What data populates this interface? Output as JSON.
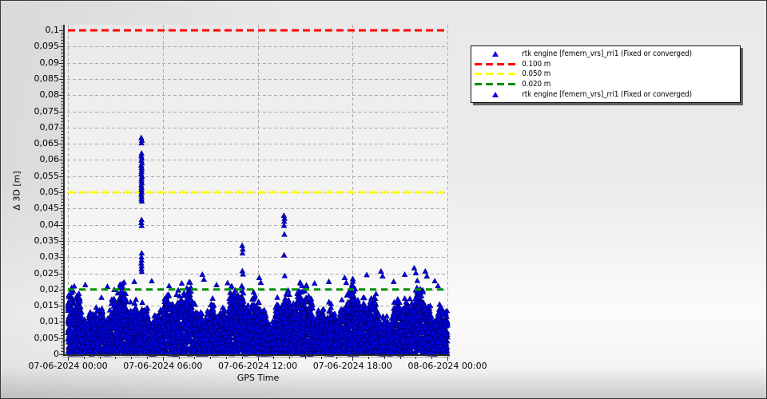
{
  "chart_data": {
    "type": "scatter",
    "title": "",
    "xlabel": "GPS Time",
    "ylabel": "Δ 3D [m]",
    "x_tick_labels": [
      "07-06-2024 00:00",
      "07-06-2024 06:00",
      "07-06-2024 12:00",
      "07-06-2024 18:00",
      "08-06-2024 00:00"
    ],
    "x_tick_hours": [
      0,
      6,
      12,
      18,
      24
    ],
    "x_minor_step_hours": 1,
    "ylim": [
      0,
      0.1
    ],
    "y_major_step": 0.005,
    "y_minor_step": 0.001,
    "y_tick_labels": [
      "0,1",
      "0,095",
      "0,09",
      "0,085",
      "0,08",
      "0,075",
      "0,07",
      "0,065",
      "0,06",
      "0,055",
      "0,05",
      "0,045",
      "0,04",
      "0,035",
      "0,03",
      "0,025",
      "0,02",
      "0,015",
      "0,01",
      "0,005",
      "0"
    ],
    "grid": "dashed",
    "legend_position": "top-right-outside",
    "series": [
      {
        "name": "rtk engine [femern_vrs]_rri1 (Fixed or converged)",
        "marker": "triangle",
        "color": "#0202ee"
      }
    ],
    "thresholds": [
      {
        "label": "0.100 m",
        "value": 0.1,
        "color": "#ff0000"
      },
      {
        "label": "0.050 m",
        "value": 0.05,
        "color": "#ffff00"
      },
      {
        "label": "0.020 m",
        "value": 0.02,
        "color": "#008f00"
      }
    ],
    "dense_band": {
      "y_min": 0.0,
      "y_typical_top": 0.016,
      "y_peak_top": 0.022,
      "point_count": 6000,
      "top_texture_points": 650
    },
    "band_envelope": {
      "base": 0.0135,
      "harmonics": [
        [
          0.003,
          1.7,
          2.0
        ],
        [
          0.002,
          4.3,
          0.0
        ],
        [
          0.0015,
          9.1,
          1.0
        ],
        [
          0.001,
          17.0,
          3.0
        ]
      ],
      "min": 0.0075,
      "max": 0.0215
    },
    "outlier_points": [
      [
        4.64,
        0.0668
      ],
      [
        4.68,
        0.066
      ],
      [
        4.65,
        0.0652
      ],
      [
        4.66,
        0.062
      ],
      [
        4.64,
        0.0612
      ],
      [
        4.67,
        0.0605
      ],
      [
        4.65,
        0.0598
      ],
      [
        4.68,
        0.059
      ],
      [
        4.64,
        0.0583
      ],
      [
        4.66,
        0.0576
      ],
      [
        4.67,
        0.057
      ],
      [
        4.65,
        0.0563
      ],
      [
        4.64,
        0.0556
      ],
      [
        4.68,
        0.0549
      ],
      [
        4.66,
        0.0542
      ],
      [
        4.65,
        0.0535
      ],
      [
        4.67,
        0.0528
      ],
      [
        4.64,
        0.0521
      ],
      [
        4.66,
        0.0514
      ],
      [
        4.65,
        0.0507
      ],
      [
        4.67,
        0.05
      ],
      [
        4.64,
        0.0493
      ],
      [
        4.66,
        0.0486
      ],
      [
        4.65,
        0.0479
      ],
      [
        4.67,
        0.0472
      ],
      [
        4.66,
        0.0415
      ],
      [
        4.64,
        0.0406
      ],
      [
        4.66,
        0.0397
      ],
      [
        4.67,
        0.0312
      ],
      [
        4.65,
        0.03
      ],
      [
        4.66,
        0.029
      ],
      [
        4.64,
        0.0281
      ],
      [
        4.66,
        0.0272
      ],
      [
        4.65,
        0.0263
      ],
      [
        4.67,
        0.0255
      ],
      [
        11.02,
        0.0335
      ],
      [
        11.06,
        0.0324
      ],
      [
        11.04,
        0.0312
      ],
      [
        11.03,
        0.0257
      ],
      [
        11.07,
        0.0247
      ],
      [
        13.66,
        0.0428
      ],
      [
        13.7,
        0.0419
      ],
      [
        13.68,
        0.041
      ],
      [
        13.67,
        0.0397
      ],
      [
        13.69,
        0.037
      ],
      [
        13.67,
        0.0306
      ],
      [
        13.71,
        0.0242
      ],
      [
        0.4,
        0.021
      ],
      [
        1.1,
        0.0214
      ],
      [
        2.5,
        0.0209
      ],
      [
        3.3,
        0.0206
      ],
      [
        4.2,
        0.0224
      ],
      [
        5.3,
        0.0226
      ],
      [
        6.4,
        0.0211
      ],
      [
        7.2,
        0.0219
      ],
      [
        8.5,
        0.0246
      ],
      [
        8.6,
        0.0231
      ],
      [
        9.4,
        0.0214
      ],
      [
        10.1,
        0.022
      ],
      [
        12.1,
        0.0236
      ],
      [
        12.2,
        0.0221
      ],
      [
        14.8,
        0.0211
      ],
      [
        15.6,
        0.0219
      ],
      [
        16.5,
        0.0224
      ],
      [
        17.5,
        0.0236
      ],
      [
        17.6,
        0.0221
      ],
      [
        18.9,
        0.0245
      ],
      [
        19.8,
        0.0256
      ],
      [
        19.9,
        0.0241
      ],
      [
        20.6,
        0.0224
      ],
      [
        21.3,
        0.0246
      ],
      [
        21.9,
        0.0266
      ],
      [
        22.0,
        0.0251
      ],
      [
        22.6,
        0.0256
      ],
      [
        22.7,
        0.0241
      ],
      [
        23.2,
        0.0226
      ],
      [
        23.4,
        0.0211
      ]
    ],
    "seed": 20240607
  },
  "legend": {
    "items": [
      {
        "marker": "triangle",
        "color": "#0202ee",
        "label": "rtk engine [femern_vrs]_rri1 (Fixed or converged)"
      },
      {
        "marker": "dash",
        "color": "#ff0000",
        "label": "0.100 m"
      },
      {
        "marker": "dash",
        "color": "#ffff00",
        "label": "0.050 m"
      },
      {
        "marker": "dash",
        "color": "#008f00",
        "label": "0.020 m"
      },
      {
        "marker": "triangle",
        "color": "#0202ee",
        "label": "rtk engine [femern_vrs]_rri1 (Fixed or converged)"
      }
    ]
  },
  "colors": {
    "point_fill": "#0202ee",
    "point_edge": "#000070",
    "grid": "#ababab",
    "axis": "#2b2b2b",
    "plot_bg_top": "#e9e9e9",
    "plot_bg_bottom": "#fdfdfd"
  }
}
